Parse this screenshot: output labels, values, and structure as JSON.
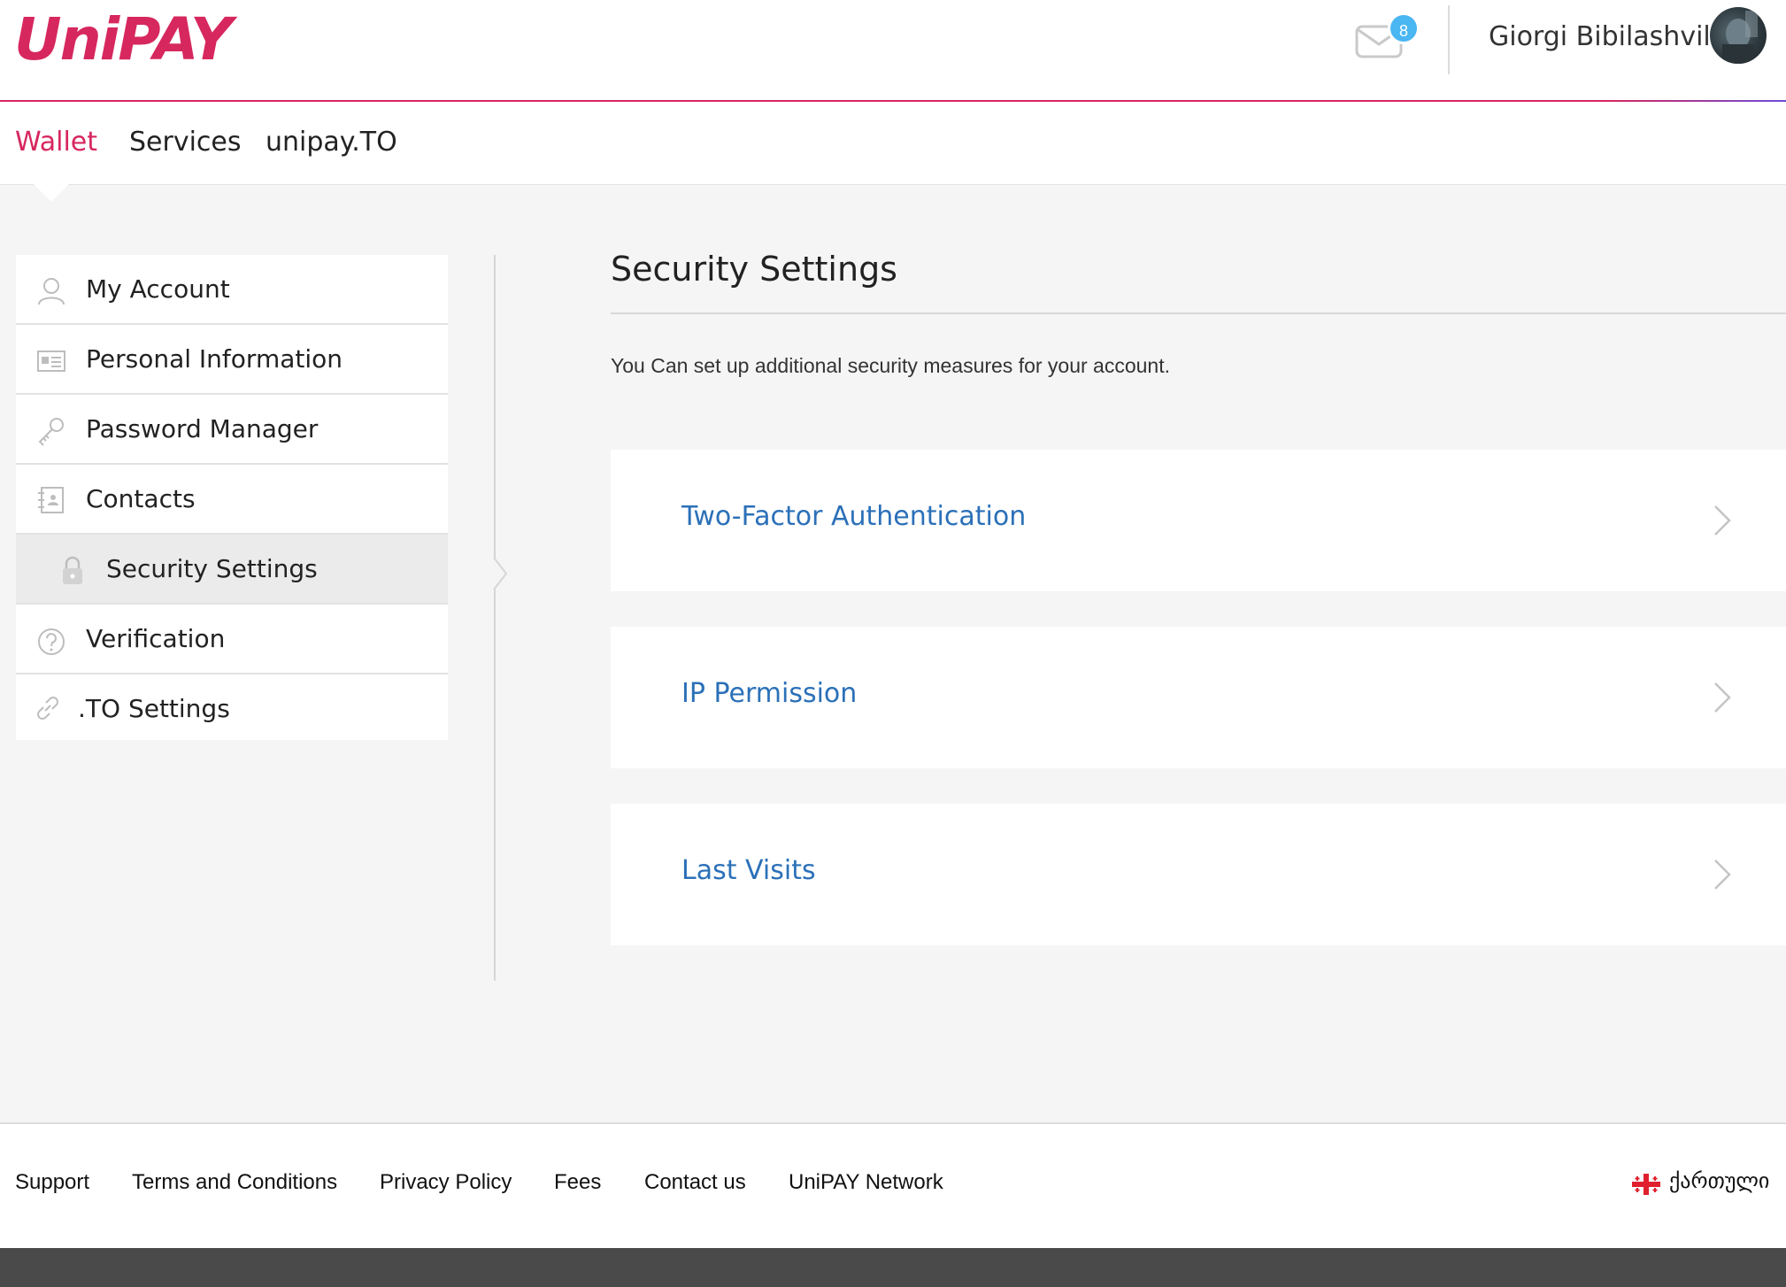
{
  "brand": {
    "logo_text": "UniPAY",
    "accent_color": "#d7275f",
    "link_color": "#2b70b8"
  },
  "header": {
    "notification_count": "8",
    "user_name": "Giorgi Bibilashvili"
  },
  "topnav": {
    "items": [
      {
        "label": "Wallet",
        "active": true
      },
      {
        "label": "Services",
        "active": false
      },
      {
        "label": "unipay.TO",
        "active": false
      }
    ]
  },
  "sidebar": {
    "items": [
      {
        "label": "My Account",
        "icon": "user-icon"
      },
      {
        "label": "Personal Information",
        "icon": "id-card-icon"
      },
      {
        "label": "Password Manager",
        "icon": "key-icon"
      },
      {
        "label": "Contacts",
        "icon": "address-book-icon"
      },
      {
        "label": "Security Settings",
        "icon": "lock-icon",
        "active": true
      },
      {
        "label": "Verification",
        "icon": "question-circle-icon"
      },
      {
        "label": ".TO Settings",
        "icon": "link-icon"
      }
    ]
  },
  "main": {
    "title": "Security Settings",
    "subtitle": "You Can set up additional security measures for your account.",
    "options": [
      {
        "label": "Two-Factor Authentication"
      },
      {
        "label": "IP Permission"
      },
      {
        "label": "Last Visits"
      }
    ]
  },
  "footer": {
    "links": [
      "Support",
      "Terms and Conditions",
      "Privacy Policy",
      "Fees",
      "Contact us",
      "UniPAY Network"
    ],
    "language": "ქართული"
  }
}
